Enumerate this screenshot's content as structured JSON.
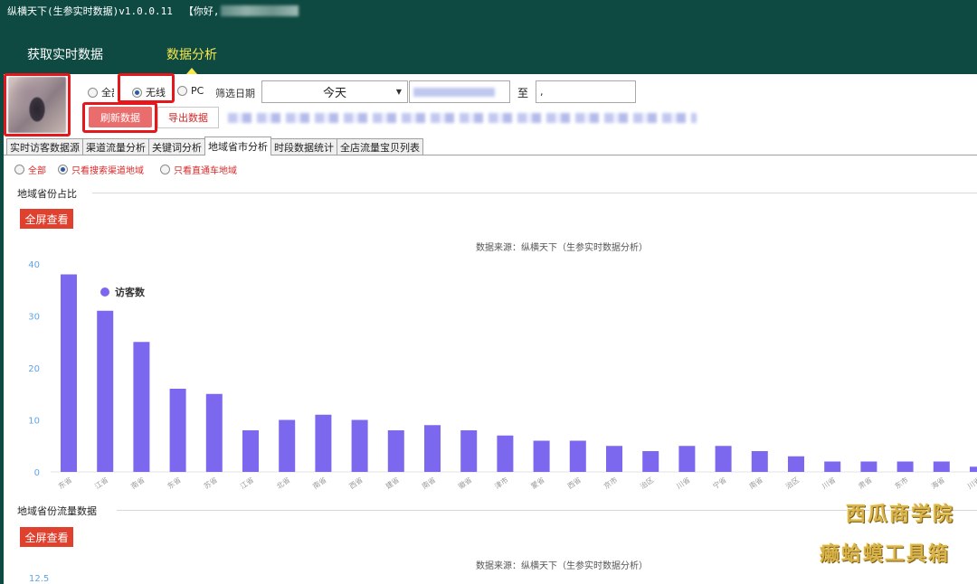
{
  "window": {
    "title": "纵横天下(生参实时数据)v1.0.0.11",
    "greeting": "【你好,"
  },
  "nav": {
    "tabs": [
      {
        "label": "获取实时数据",
        "active": false
      },
      {
        "label": "数据分析",
        "active": true
      }
    ]
  },
  "filters": {
    "device_options": [
      "全部",
      "无线",
      "PC"
    ],
    "device_selected": "无线",
    "date_label": "筛选日期",
    "date_range_value": "今天",
    "to_label": "至",
    "end_date_fragment": ","
  },
  "actions": {
    "refresh_label": "刷新数据",
    "export_label": "导出数据"
  },
  "subtabs": [
    {
      "label": "实时访客数据源",
      "active": false
    },
    {
      "label": "渠道流量分析",
      "active": false
    },
    {
      "label": "关键词分析",
      "active": false
    },
    {
      "label": "地域省市分析",
      "active": true
    },
    {
      "label": "时段数据统计",
      "active": false
    },
    {
      "label": "全店流量宝贝列表",
      "active": false
    }
  ],
  "region_filter": {
    "options": [
      "全部",
      "只看搜索渠道地域",
      "只看直通车地域"
    ],
    "selected": "只看搜索渠道地域"
  },
  "section1": {
    "title": "地域省份占比",
    "fullscreen_label": "全屏查看",
    "source_label": "数据来源：纵横天下（生参实时数据分析）"
  },
  "section2": {
    "title": "地域省份流量数据",
    "fullscreen_label": "全屏查看",
    "source_label": "数据来源：纵横天下（生参实时数据分析）",
    "first_tick": "12.5"
  },
  "chart_data": {
    "type": "bar",
    "title": "",
    "xlabel": "",
    "ylabel": "",
    "ylim": [
      0,
      40
    ],
    "yticks": [
      0,
      10,
      20,
      30,
      40
    ],
    "grid": false,
    "legend_position": "top-left",
    "series": [
      {
        "name": "访客数",
        "color": "#7b68ee",
        "values": [
          38,
          31,
          25,
          16,
          15,
          8,
          10,
          11,
          10,
          8,
          9,
          8,
          7,
          6,
          6,
          5,
          4,
          5,
          5,
          4,
          3,
          2,
          2,
          2,
          2,
          1
        ]
      }
    ],
    "categories": [
      "东省",
      "江省",
      "南省",
      "东省",
      "苏省",
      "江省",
      "北省",
      "南省",
      "西省",
      "建省",
      "南省",
      "徽省",
      "津市",
      "蒙省",
      "西省",
      "京市",
      "治区",
      "川省",
      "宁省",
      "南省",
      "治区",
      "川省",
      "肃省",
      "东市",
      "海省",
      "川省"
    ]
  },
  "watermark": {
    "line1": "西瓜商学院",
    "line2": "癞蛤蟆工具箱"
  }
}
